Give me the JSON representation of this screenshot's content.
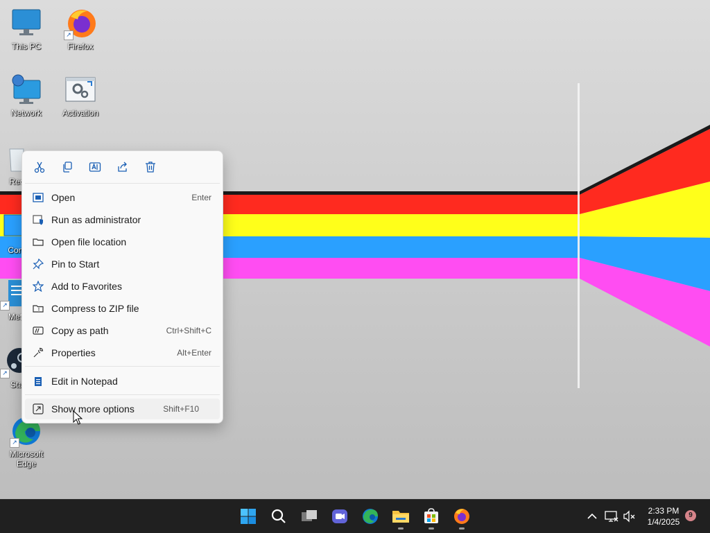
{
  "desktop": {
    "icons": [
      {
        "label": "This PC"
      },
      {
        "label": "Firefox"
      },
      {
        "label": "Network"
      },
      {
        "label": "Activation"
      },
      {
        "label": "Rec"
      },
      {
        "label": "Cont"
      },
      {
        "label": "Metr"
      },
      {
        "label": "Sta"
      },
      {
        "label": "Microsoft Edge"
      }
    ]
  },
  "context_menu": {
    "quick_actions": [
      {
        "icon": "cut-icon"
      },
      {
        "icon": "copy-icon"
      },
      {
        "icon": "rename-icon"
      },
      {
        "icon": "share-icon"
      },
      {
        "icon": "delete-icon"
      }
    ],
    "items": [
      {
        "label": "Open",
        "shortcut": "Enter",
        "icon": "open-icon"
      },
      {
        "label": "Run as administrator",
        "shortcut": "",
        "icon": "shield-icon"
      },
      {
        "label": "Open file location",
        "shortcut": "",
        "icon": "folder-icon"
      },
      {
        "label": "Pin to Start",
        "shortcut": "",
        "icon": "pin-icon"
      },
      {
        "label": "Add to Favorites",
        "shortcut": "",
        "icon": "star-icon"
      },
      {
        "label": "Compress to ZIP file",
        "shortcut": "",
        "icon": "zip-icon"
      },
      {
        "label": "Copy as path",
        "shortcut": "Ctrl+Shift+C",
        "icon": "copy-path-icon"
      },
      {
        "label": "Properties",
        "shortcut": "Alt+Enter",
        "icon": "wrench-icon"
      },
      {
        "label": "Edit in Notepad",
        "shortcut": "",
        "icon": "notepad-icon"
      },
      {
        "label": "Show more options",
        "shortcut": "Shift+F10",
        "icon": "more-options-icon"
      }
    ]
  },
  "taskbar": {
    "apps": [
      {
        "icon": "start-icon"
      },
      {
        "icon": "search-icon"
      },
      {
        "icon": "task-view-icon"
      },
      {
        "icon": "meet-icon"
      },
      {
        "icon": "edge-icon"
      },
      {
        "icon": "file-explorer-icon"
      },
      {
        "icon": "store-icon"
      },
      {
        "icon": "firefox-icon"
      }
    ],
    "clock": {
      "time": "2:33 PM",
      "date": "1/4/2025"
    },
    "notification_count": "9"
  },
  "colors": {
    "stripe_red": "#ff2a1f",
    "stripe_yellow": "#ffff1a",
    "stripe_blue": "#2aa0ff",
    "stripe_magenta": "#ff4df2",
    "taskbar": "#202020",
    "menu_icon_blue": "#1a5fb4"
  }
}
